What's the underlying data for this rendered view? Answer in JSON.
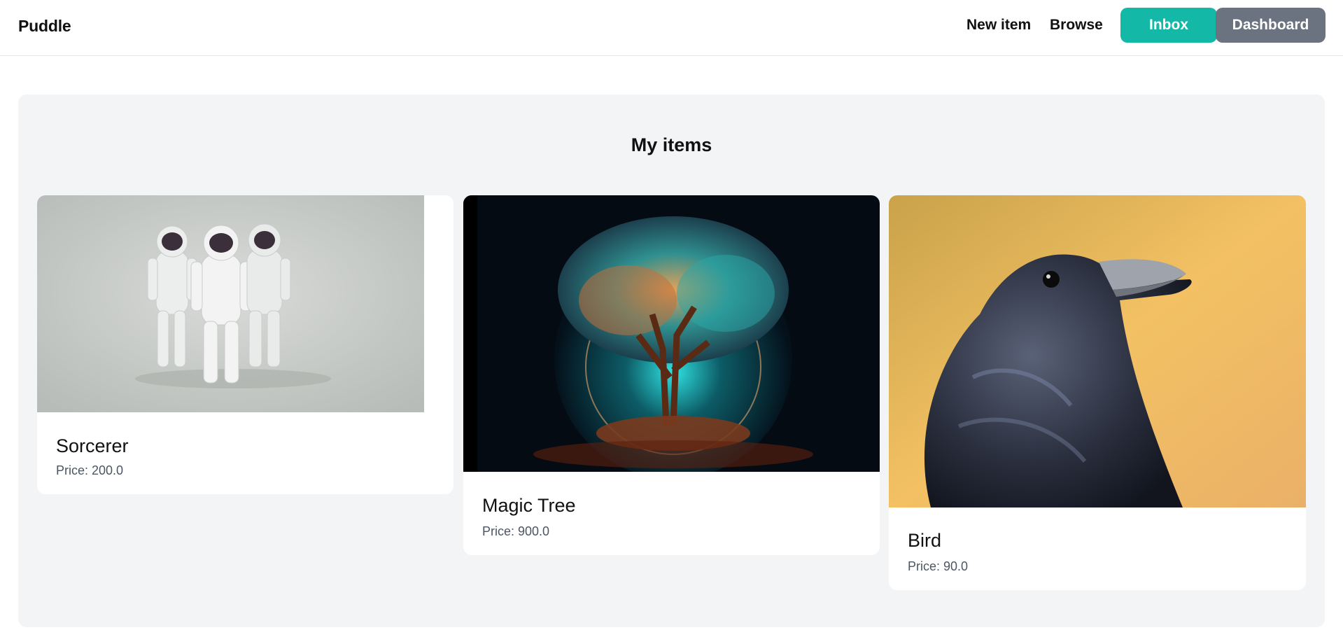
{
  "nav": {
    "brand": "Puddle",
    "new_item": "New item",
    "browse": "Browse",
    "inbox": "Inbox",
    "dashboard": "Dashboard"
  },
  "main": {
    "title": "My items",
    "items": [
      {
        "name": "Sorcerer",
        "price": "Price: 200.0",
        "image": "astronauts-image"
      },
      {
        "name": "Magic Tree",
        "price": "Price: 900.0",
        "image": "magic-tree-image"
      },
      {
        "name": "Bird",
        "price": "Price: 90.0",
        "image": "crow-image"
      }
    ]
  },
  "colors": {
    "inbox_button": "#14b8a6",
    "dashboard_button": "#6b7280",
    "panel_background": "#f3f4f6"
  }
}
